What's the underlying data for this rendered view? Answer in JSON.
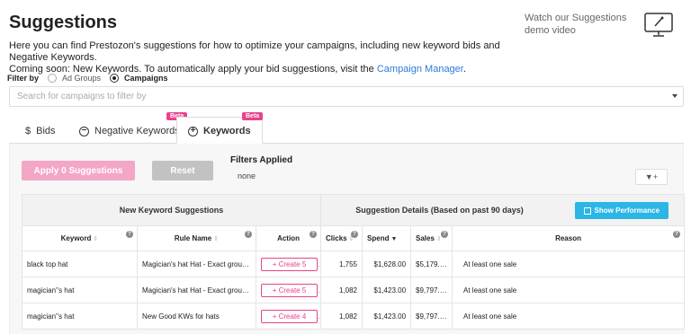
{
  "header": {
    "title": "Suggestions",
    "demo_text": "Watch our Suggestions demo video",
    "description_line1": "Here you can find Prestozon's suggestions for how to optimize your campaigns, including new keyword bids and Negative Keywords.",
    "description_line2": "Coming soon: New Keywords. To automatically apply your bid suggestions, visit the",
    "campaign_manager_link": "Campaign Manager",
    "period": "."
  },
  "filter": {
    "label": "Filter by",
    "options": [
      {
        "label": "Ad Groups",
        "selected": false
      },
      {
        "label": "Campaigns",
        "selected": true
      }
    ],
    "search_placeholder": "Search for campaigns to filter by"
  },
  "tabs": [
    {
      "label": "Bids",
      "icon": "dollar-icon",
      "symbol": "$",
      "badge": ""
    },
    {
      "label": "Negative Keywords",
      "icon": "minus-circle-icon",
      "symbol": "−",
      "badge": "Beta"
    },
    {
      "label": "Keywords",
      "icon": "plus-circle-icon",
      "symbol": "+",
      "badge": "Beta",
      "active": true
    }
  ],
  "toolbar": {
    "apply_label": "Apply 0 Suggestions",
    "reset_label": "Reset",
    "filters_applied_title": "Filters Applied",
    "filters_applied_value": "none",
    "filter_button_icon": "▼+"
  },
  "table": {
    "group_headers": {
      "left": "New Keyword Suggestions",
      "right": "Suggestion Details (Based on past 90 days)",
      "show_performance": "Show Performance"
    },
    "columns": [
      "Keyword",
      "Rule Name",
      "Action",
      "Clicks",
      "Spend",
      "Sales",
      "Reason"
    ],
    "rows": [
      {
        "keyword": "black top hat",
        "rule": "Magician's hat Hat - Exact group ...",
        "action": "+ Create 5",
        "clicks": "1,755",
        "spend": "$1,628.00",
        "sales": "$5,179.00",
        "reason": "At least one sale"
      },
      {
        "keyword": "magician''s hat",
        "rule": "Magician's hat Hat - Exact group ...",
        "action": "+ Create 5",
        "clicks": "1,082",
        "spend": "$1,423.00",
        "sales": "$9,797.00",
        "reason": "At least one sale"
      },
      {
        "keyword": "magician''s hat",
        "rule": "New Good KWs for hats",
        "action": "+ Create 4",
        "clicks": "1,082",
        "spend": "$1,423.00",
        "sales": "$9,797.00",
        "reason": "At least one sale"
      }
    ]
  },
  "colors": {
    "accent_pink": "#e8428c",
    "accent_blue": "#2bb6e6",
    "link": "#2b7bd6"
  }
}
